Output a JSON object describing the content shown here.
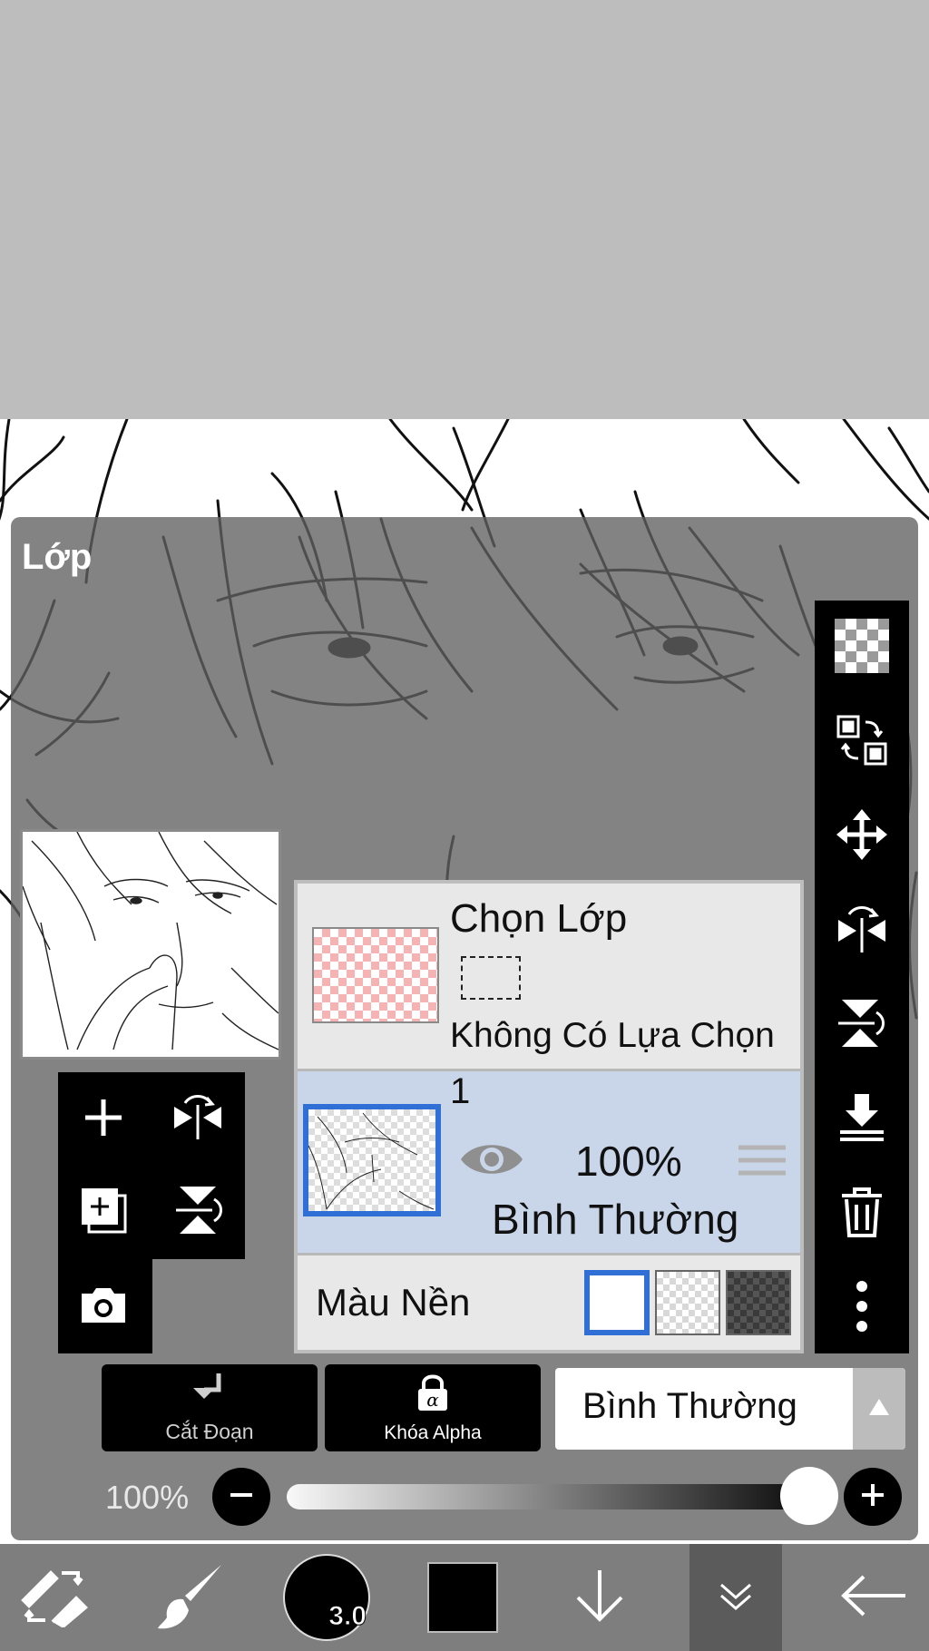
{
  "panel": {
    "title": "Lớp"
  },
  "layers": {
    "selection": {
      "title": "Chọn Lớp",
      "subtitle": "Không Có Lựa Chọn"
    },
    "layer1": {
      "name": "1",
      "opacity": "100%",
      "blend": "Bình Thường",
      "visible": true
    },
    "background": {
      "label": "Màu Nền",
      "options": [
        "white",
        "transparent",
        "dark-checker"
      ],
      "selected": "white"
    }
  },
  "controls": {
    "clip_label": "Cắt Đoạn",
    "alpha_lock_label": "Khóa Alpha",
    "blend_mode": "Bình Thường",
    "opacity_label": "100%",
    "opacity_value": 1.0
  },
  "bottom_bar": {
    "brush_size": "3.0"
  },
  "colors": {
    "accent": "#2f6fd6",
    "layer_selected_bg": "#c9d6ea",
    "panel_bg": "#e8e8e8",
    "toolbar": "#000000"
  },
  "icons": [
    "add-layer-icon",
    "flip-horizontal-icon",
    "duplicate-layer-icon",
    "flip-vertical-icon",
    "camera-icon",
    "transparency-icon",
    "swap-icon",
    "move-icon",
    "flip-layer-horizontal-icon",
    "flip-layer-vertical-icon",
    "merge-down-icon",
    "trash-icon",
    "more-icon",
    "clip-arrow-icon",
    "lock-icon",
    "minus-icon",
    "plus-icon",
    "transform-tools-icon",
    "brush-icon",
    "arrow-down-icon",
    "collapse-icon",
    "back-arrow-icon"
  ]
}
